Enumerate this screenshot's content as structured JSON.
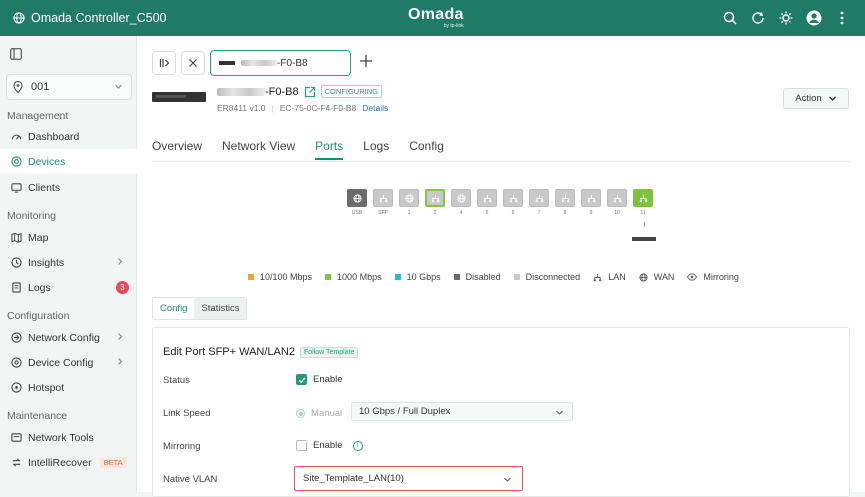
{
  "topbar": {
    "brand": "Omada Controller_C500",
    "logo": "Omada",
    "logo_sub": "by tp-link",
    "icons": [
      "search-icon",
      "refresh-icon",
      "brightness-icon",
      "avatar",
      "more-icon"
    ]
  },
  "sidebar": {
    "site": "001",
    "sections": {
      "management": "Management",
      "monitoring": "Monitoring",
      "configuration": "Configuration",
      "maintenance": "Maintenance"
    },
    "items": {
      "dashboard": "Dashboard",
      "devices": "Devices",
      "clients": "Clients",
      "map": "Map",
      "insights": "Insights",
      "logs": "Logs",
      "logs_badge": "3",
      "network_config": "Network Config",
      "device_config": "Device Config",
      "hotspot": "Hotspot",
      "network_tools": "Network Tools",
      "intellirecover": "IntelliRecover",
      "beta": "BETA"
    }
  },
  "device": {
    "tab_label": "-F0-B8",
    "name_suffix": "-F0-B8",
    "status": "CONFIGURING",
    "model": "ER8411 v1.0",
    "mac": "EC-75-0C-F4-F0-B8",
    "details": "Details",
    "action": "Action"
  },
  "tabs": [
    "Overview",
    "Network View",
    "Ports",
    "Logs",
    "Config"
  ],
  "active_tab": "Ports",
  "ports": [
    {
      "label": "USB",
      "state": "disabled"
    },
    {
      "label": "SFP",
      "state": "disconnected"
    },
    {
      "label": "1",
      "state": "disconnected"
    },
    {
      "label": "2",
      "state": "selected"
    },
    {
      "label": "4",
      "state": "disconnected"
    },
    {
      "label": "5",
      "state": "disconnected"
    },
    {
      "label": "6",
      "state": "disconnected"
    },
    {
      "label": "7",
      "state": "disconnected"
    },
    {
      "label": "8",
      "state": "disconnected"
    },
    {
      "label": "9",
      "state": "disconnected"
    },
    {
      "label": "10",
      "state": "disconnected"
    },
    {
      "label": "11",
      "state": "1000"
    }
  ],
  "legend": {
    "l1": "10/100 Mbps",
    "l2": "1000 Mbps",
    "l3": "10 Gbps",
    "l4": "Disabled",
    "l5": "Disconnected",
    "l6": "LAN",
    "l7": "WAN",
    "l8": "Mirroring"
  },
  "colors": {
    "primary": "#1f7a66",
    "l1": "#f5a623",
    "l2": "#7fc241",
    "l3": "#1fc0d6",
    "l4": "#6b6b6b",
    "l5": "#c9c9c9"
  },
  "subtabs": {
    "config": "Config",
    "statistics": "Statistics"
  },
  "form": {
    "title": "Edit Port SFP+ WAN/LAN2",
    "follow": "Follow Template",
    "status_label": "Status",
    "status_value": "Enable",
    "link_speed_label": "Link Speed",
    "manual": "Manual",
    "speed_value": "10 Gbps / Full Duplex",
    "mirroring_label": "Mirroring",
    "mirroring_value": "Enable",
    "native_vlan_label": "Native VLAN",
    "native_vlan_value": "Site_Template_LAN(10)"
  }
}
